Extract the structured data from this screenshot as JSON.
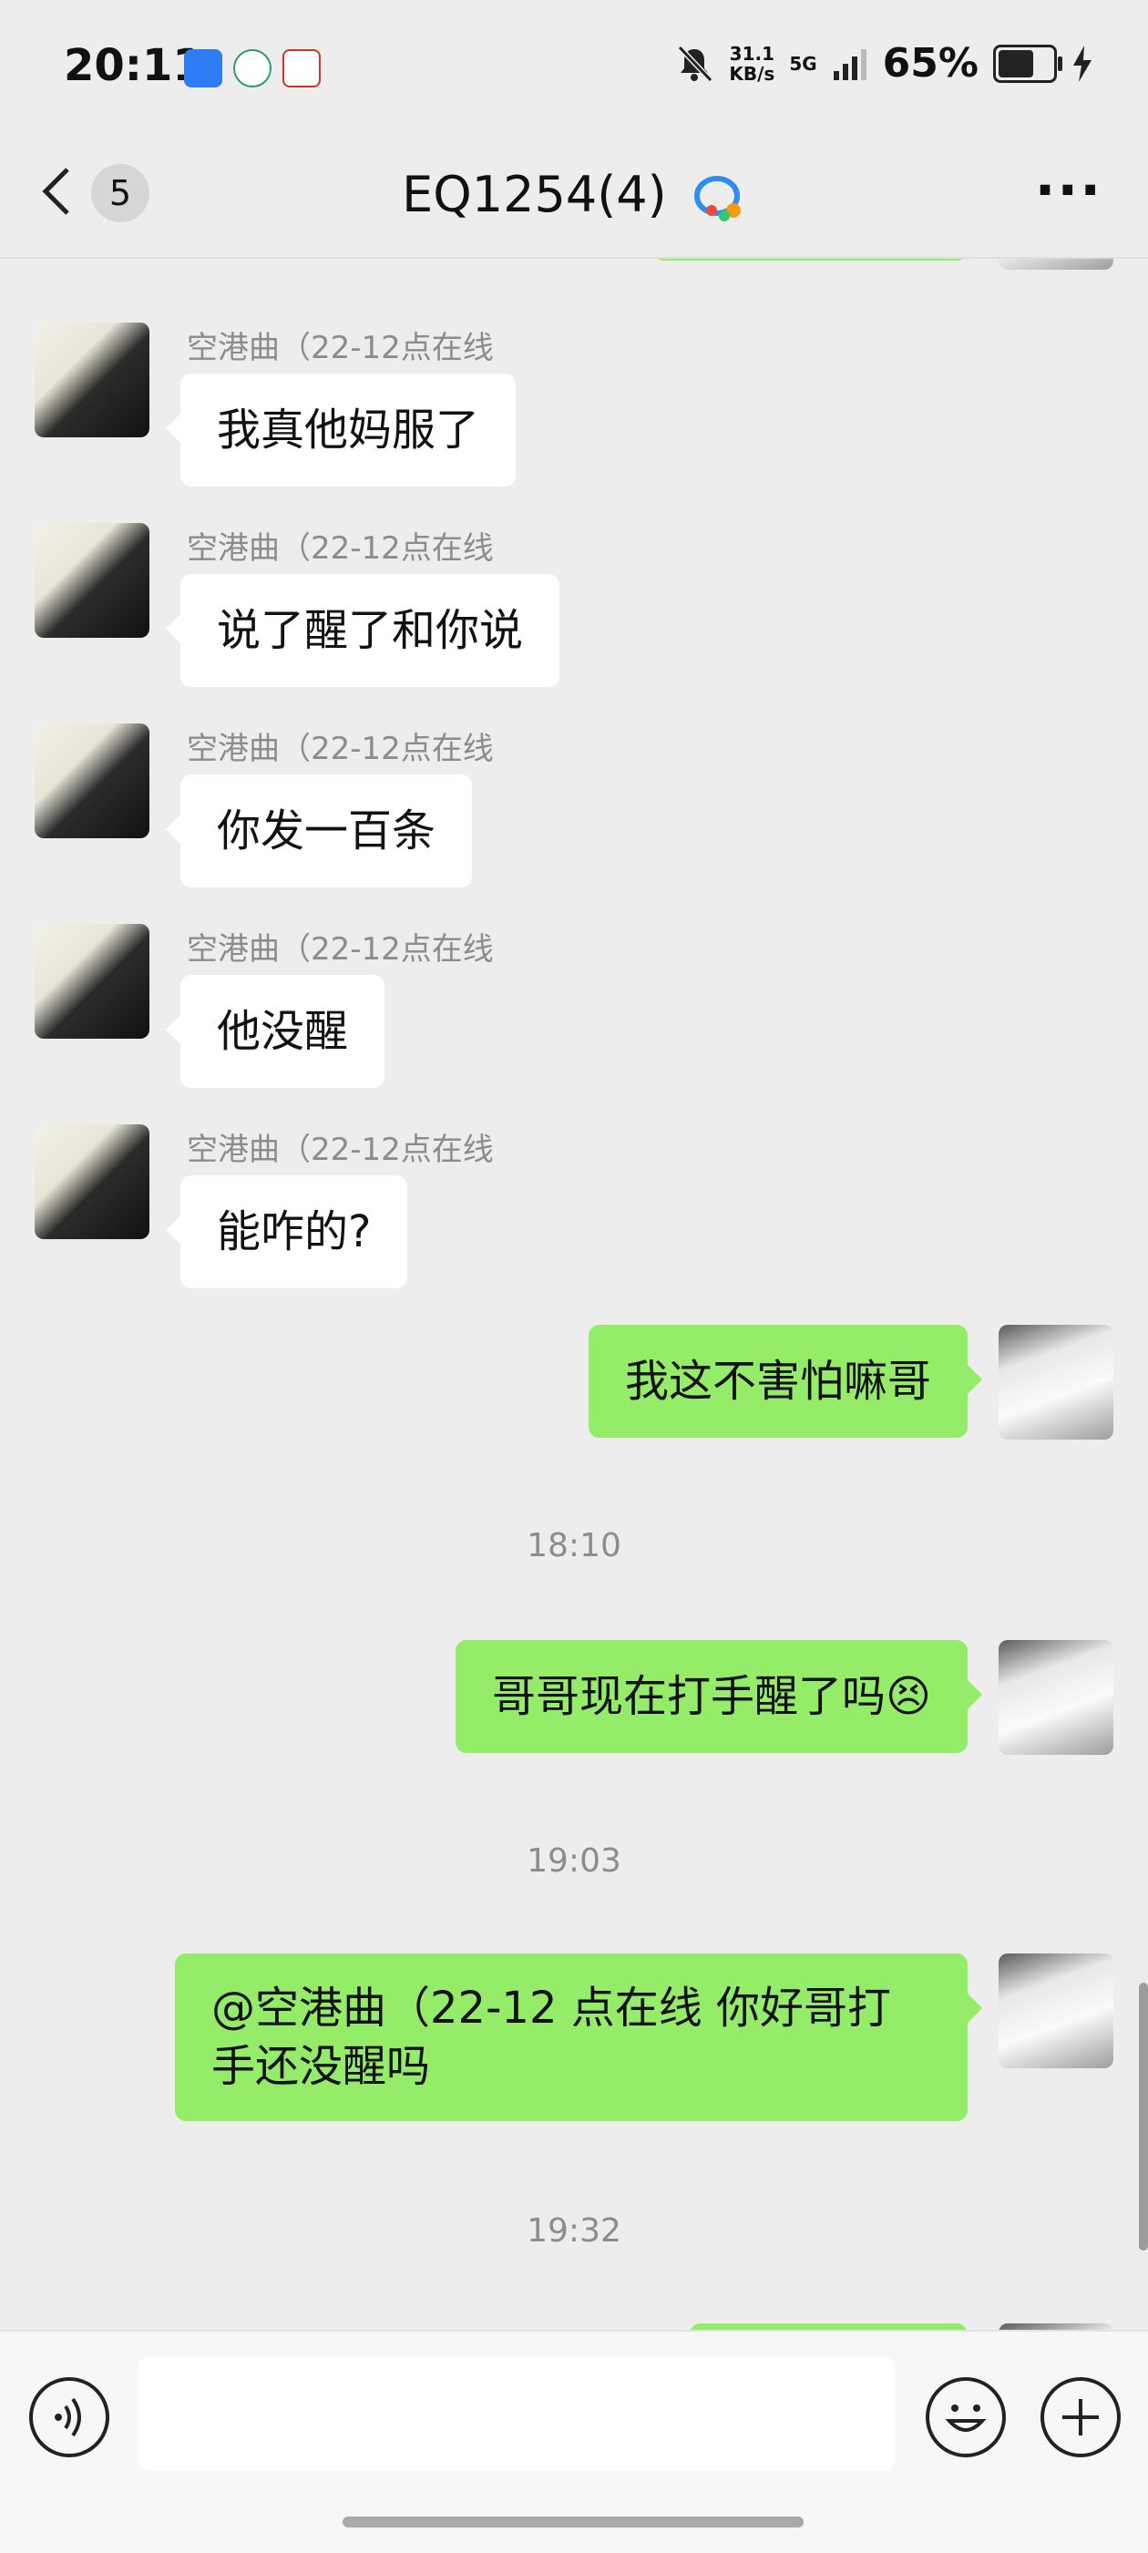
{
  "status": {
    "time": "20:11",
    "speed_value": "31.1",
    "speed_unit": "KB/s",
    "network": "5G",
    "battery_percent": "65%",
    "battery_level": 0.65
  },
  "header": {
    "back_icon": "chevron-left-icon",
    "unread_count": "5",
    "title": "EQ1254(4)",
    "more_icon": "ellipsis-icon"
  },
  "messages": [
    {
      "sender": "空港曲（22-12点在线",
      "text": "我真他妈服了"
    },
    {
      "sender": "空港曲（22-12点在线",
      "text": "说了醒了和你说"
    },
    {
      "sender": "空港曲（22-12点在线",
      "text": "你发一百条"
    },
    {
      "sender": "空港曲（22-12点在线",
      "text": "他没醒"
    },
    {
      "sender": "空港曲（22-12点在线",
      "text": "能咋的?"
    }
  ],
  "outgoing": {
    "msg1": "我这不害怕嘛哥",
    "msg2": "哥哥现在打手醒了吗😣",
    "msg3": "@空港曲（22-12 点在线  你好哥打手还没醒吗"
  },
  "timestamps": [
    "18:10",
    "19:03",
    "19:32"
  ],
  "input": {
    "voice_icon": "voice-icon",
    "value": "",
    "emoji_icon": "emoji-icon",
    "plus_icon": "plus-icon"
  }
}
